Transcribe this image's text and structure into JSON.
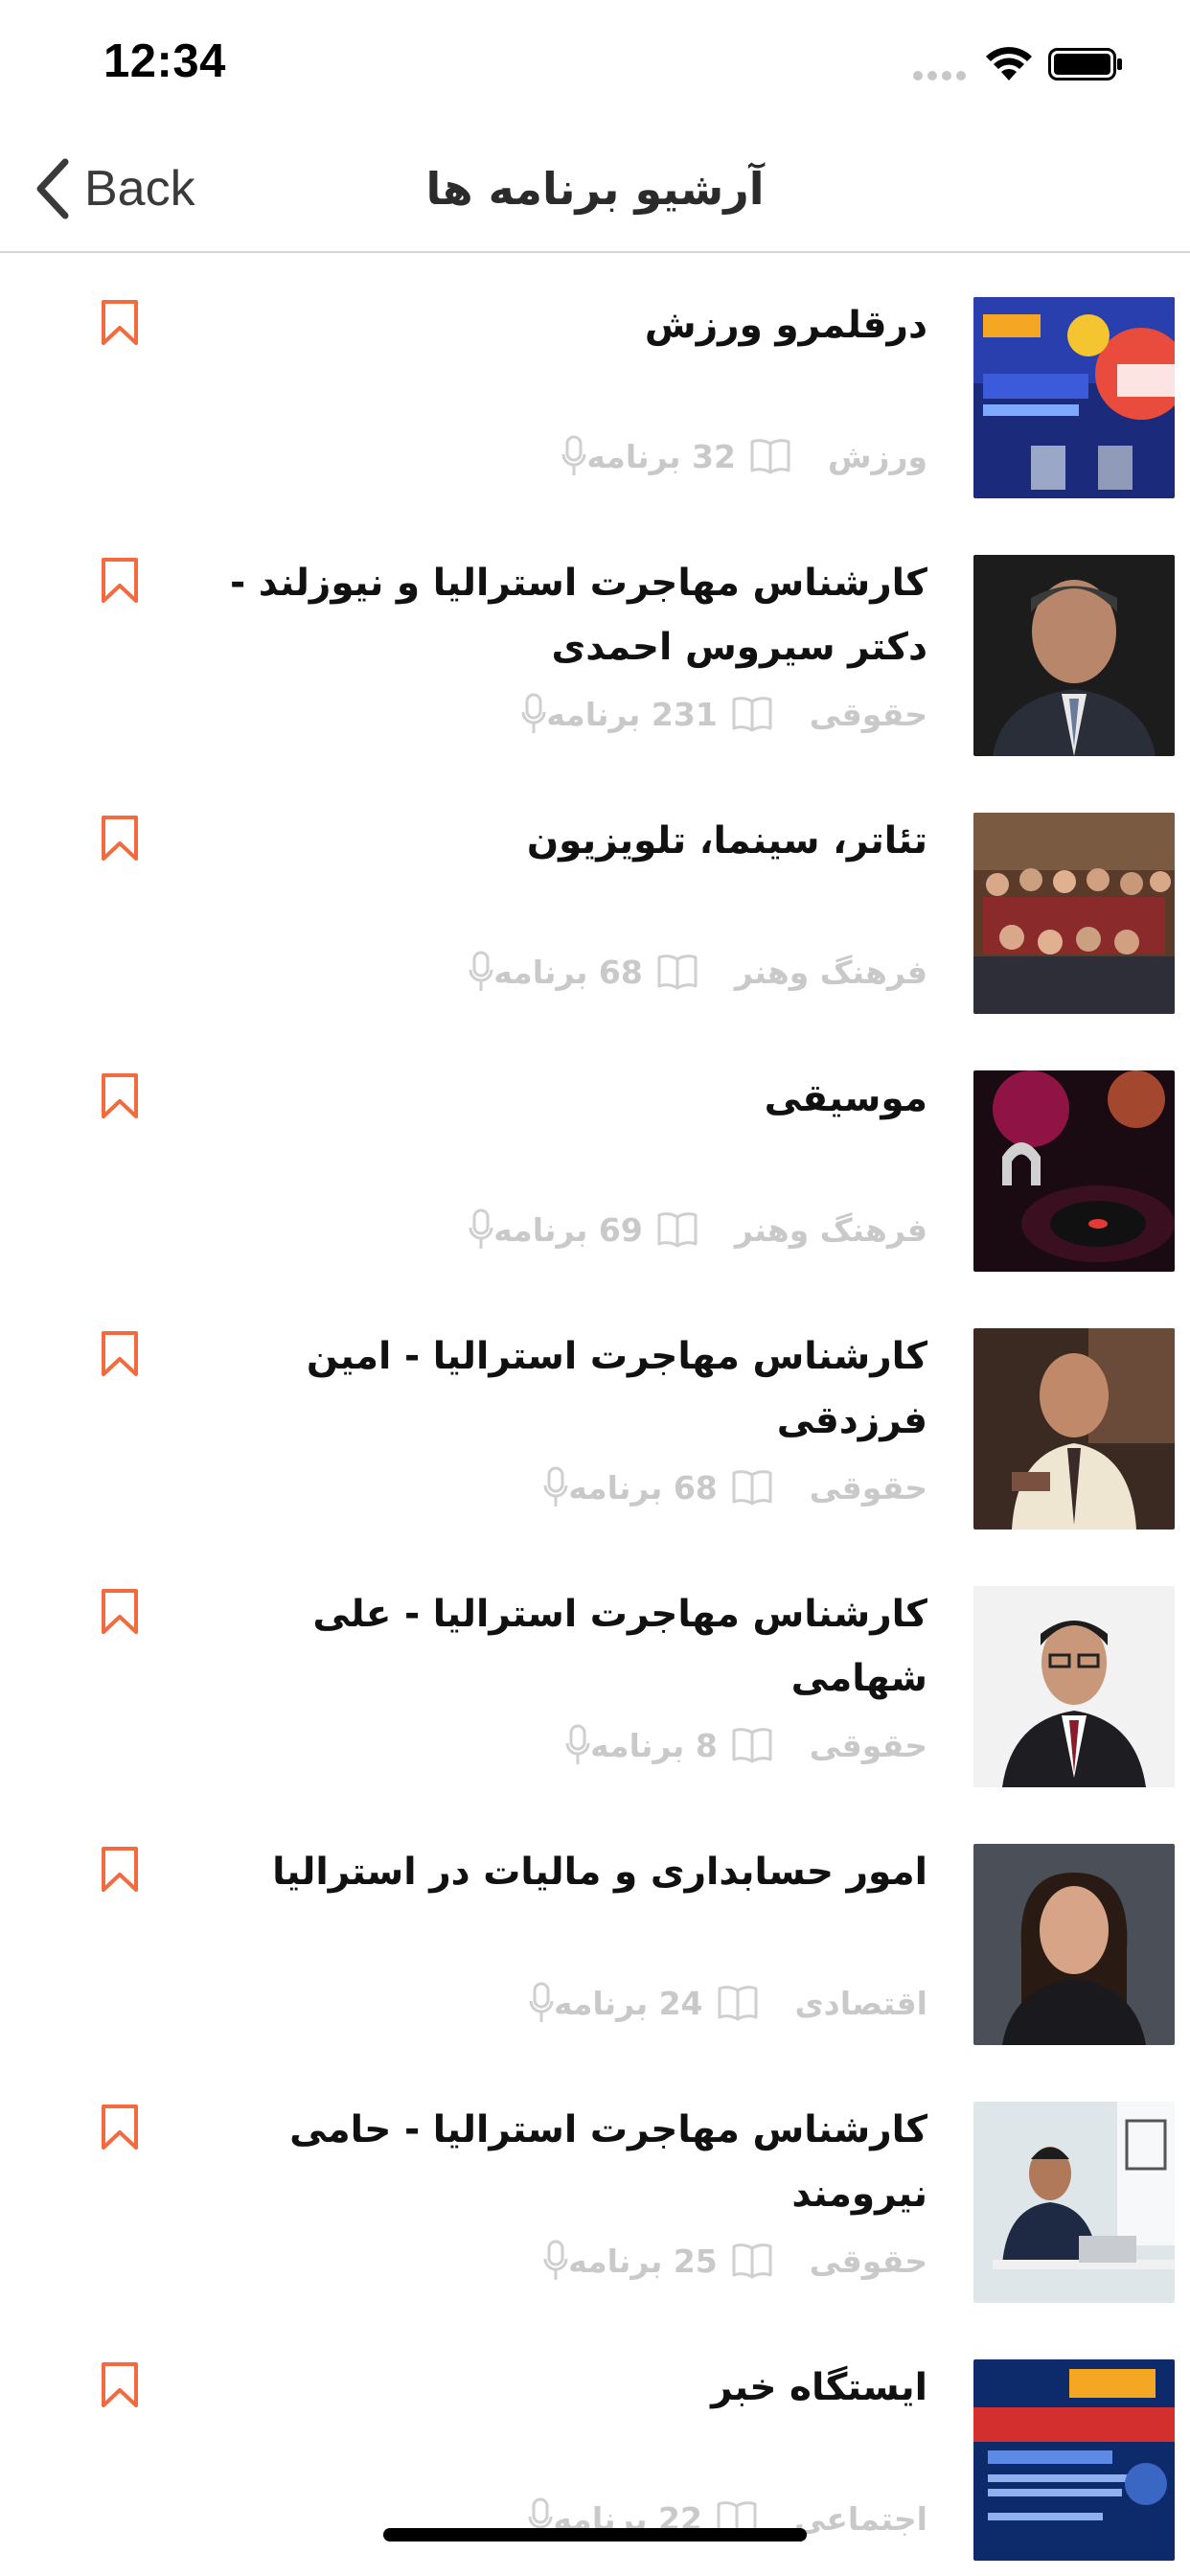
{
  "status_bar": {
    "time": "12:34"
  },
  "nav": {
    "back_label": "Back",
    "title": "آرشیو برنامه ها"
  },
  "theme": {
    "accent": "#f26a3d",
    "meta_gray": "#c9c9c9",
    "title_color": "#111111"
  },
  "programs": [
    {
      "title": "درقلمرو ورزش",
      "count": "32 برنامه",
      "category": "ورزش",
      "thumb": "sports-poster"
    },
    {
      "title": "کارشناس مهاجرت استرالیا و نیوزلند - دکتر سیروس احمدی",
      "count": "231 برنامه",
      "category": "حقوقی",
      "thumb": "portrait-man-suit"
    },
    {
      "title": "تئاتر، سینما، تلویزیون",
      "count": "68 برنامه",
      "category": "فرهنگ وهنر",
      "thumb": "group-photo"
    },
    {
      "title": "موسیقی",
      "count": "69 برنامه",
      "category": "فرهنگ وهنر",
      "thumb": "dj-turntable"
    },
    {
      "title": "کارشناس مهاجرت استرالیا  - امین فرزدقی",
      "count": "68 برنامه",
      "category": "حقوقی",
      "thumb": "portrait-man-tie"
    },
    {
      "title": "کارشناس مهاجرت استرالیا - علی شهامی",
      "count": "8 برنامه",
      "category": "حقوقی",
      "thumb": "portrait-man-glasses"
    },
    {
      "title": "امور حسابداری و مالیات در استرالیا",
      "count": "24 برنامه",
      "category": "اقتصادی",
      "thumb": "portrait-woman"
    },
    {
      "title": "کارشناس مهاجرت استرالیا - حامی نیرومند",
      "count": "25 برنامه",
      "category": "حقوقی",
      "thumb": "man-at-desk"
    },
    {
      "title": "ایستگاه خبر",
      "count": "22 برنامه",
      "category": "اجتماعی",
      "thumb": "news-station-poster"
    }
  ]
}
